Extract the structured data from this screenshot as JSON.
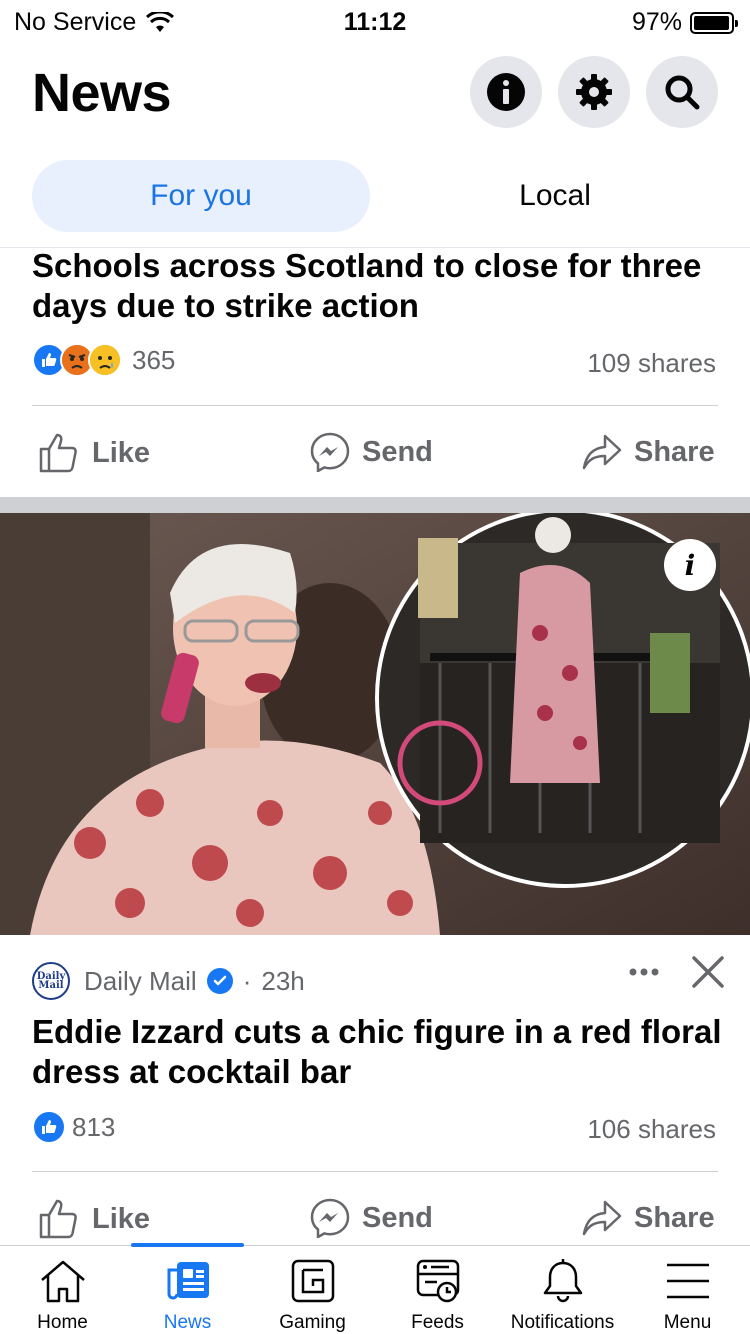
{
  "status_bar": {
    "carrier": "No Service",
    "time": "11:12",
    "battery": "97%",
    "battery_level": 0.97
  },
  "header": {
    "title": "News"
  },
  "tabs": [
    {
      "label": "For you",
      "active": true
    },
    {
      "label": "Local",
      "active": false
    }
  ],
  "posts": [
    {
      "title": "Schools across Scotland to close for three days due to strike action",
      "reaction_count": "365",
      "shares": "109 shares",
      "actions": {
        "like": "Like",
        "send": "Send",
        "share": "Share"
      }
    },
    {
      "source": "Daily Mail",
      "logo_text": "Daily Mail",
      "time": "23h",
      "separator": "·",
      "title": "Eddie Izzard cuts a chic figure in a red floral dress at cocktail bar",
      "reaction_count": "813",
      "shares": "106 shares",
      "actions": {
        "like": "Like",
        "send": "Send",
        "share": "Share"
      }
    }
  ],
  "nav": {
    "items": [
      {
        "label": "Home"
      },
      {
        "label": "News"
      },
      {
        "label": "Gaming"
      },
      {
        "label": "Feeds"
      },
      {
        "label": "Notifications"
      },
      {
        "label": "Menu"
      }
    ]
  },
  "colors": {
    "accent": "#1877f2",
    "secondary_text": "#65676b",
    "tab_active_bg": "#e7f0fc"
  }
}
